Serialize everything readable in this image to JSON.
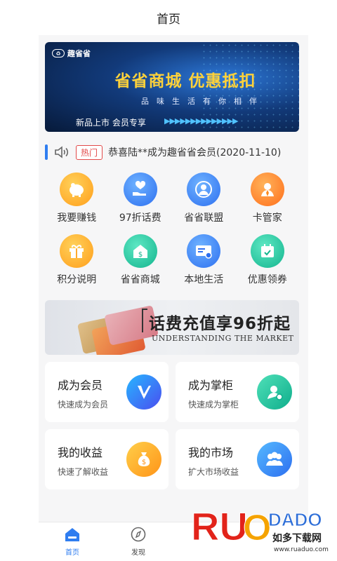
{
  "header": {
    "title": "首页"
  },
  "banner": {
    "logo_text": "趣省省",
    "headline": "省省商城  优惠抵扣",
    "subline": "品味生活有你相伴",
    "tags": "新品上市    会员专享",
    "arrows": "▶▶▶▶▶▶▶▶▶▶▶▶▶▶"
  },
  "notice": {
    "tag": "热门",
    "message": "恭喜陆**成为趣省省会员(2020-11-10)"
  },
  "grid": {
    "items": [
      {
        "label": "我要赚钱",
        "icon": "piggy-bank-icon",
        "color": "#ffb02e"
      },
      {
        "label": "97折话费",
        "icon": "heart-hand-icon",
        "color": "#3f8df2"
      },
      {
        "label": "省省联盟",
        "icon": "user-circle-icon",
        "color": "#3f8df2"
      },
      {
        "label": "卡管家",
        "icon": "person-card-icon",
        "color": "#ff8a1f"
      },
      {
        "label": "积分说明",
        "icon": "gift-box-icon",
        "color": "#ffaa2e"
      },
      {
        "label": "省省商城",
        "icon": "shop-house-icon",
        "color": "#1ec7a2"
      },
      {
        "label": "本地生活",
        "icon": "id-card-icon",
        "color": "#3f8df2"
      },
      {
        "label": "优惠领券",
        "icon": "calendar-check-icon",
        "color": "#1ec7a2"
      }
    ]
  },
  "promo": {
    "headline": "话费充值享96折起",
    "english": "UNDERSTANDING THE MARKET"
  },
  "tiles": [
    {
      "title": "成为会员",
      "subtitle": "快速成为会员",
      "icon": "v-badge-icon",
      "color": "#3f6ff2"
    },
    {
      "title": "成为掌柜",
      "subtitle": "快速成为掌柜",
      "icon": "person-settings-icon",
      "color": "#1ec7a2"
    },
    {
      "title": "我的收益",
      "subtitle": "快速了解收益",
      "icon": "money-bag-icon",
      "color": "#ffaa2e"
    },
    {
      "title": "我的市场",
      "subtitle": "扩大市场收益",
      "icon": "people-group-icon",
      "color": "#3f8df2"
    }
  ],
  "tabbar": {
    "home_label": "首页",
    "discover_label": "发现",
    "active_color": "#2f7df0"
  },
  "watermark": {
    "brand": "RUANDADO",
    "cn": "如多下载网",
    "url": "www.ruaduo.com"
  }
}
